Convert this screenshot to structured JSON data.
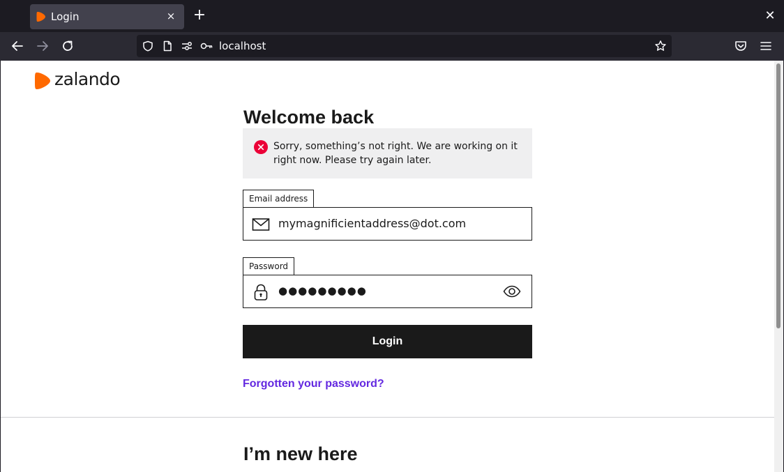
{
  "browser": {
    "tab": {
      "title": "Login",
      "close": "×"
    },
    "new_tab": "+",
    "window_close": "✕",
    "url": "localhost"
  },
  "page": {
    "brand": "zalando",
    "title": "Welcome back",
    "error": {
      "message": "Sorry, something’s not right. We are working on it right now. Please try again later."
    },
    "email": {
      "label": "Email address",
      "value": "mymagnificientaddress@dot.com"
    },
    "password": {
      "label": "Password",
      "value": "●●●●●●●●●"
    },
    "login_label": "Login",
    "forgot_label": "Forgotten your password?",
    "new_title": "I’m new here"
  },
  "colors": {
    "brand_orange": "#ff6900",
    "error_red": "#eb0037",
    "link_purple": "#6328e0"
  }
}
